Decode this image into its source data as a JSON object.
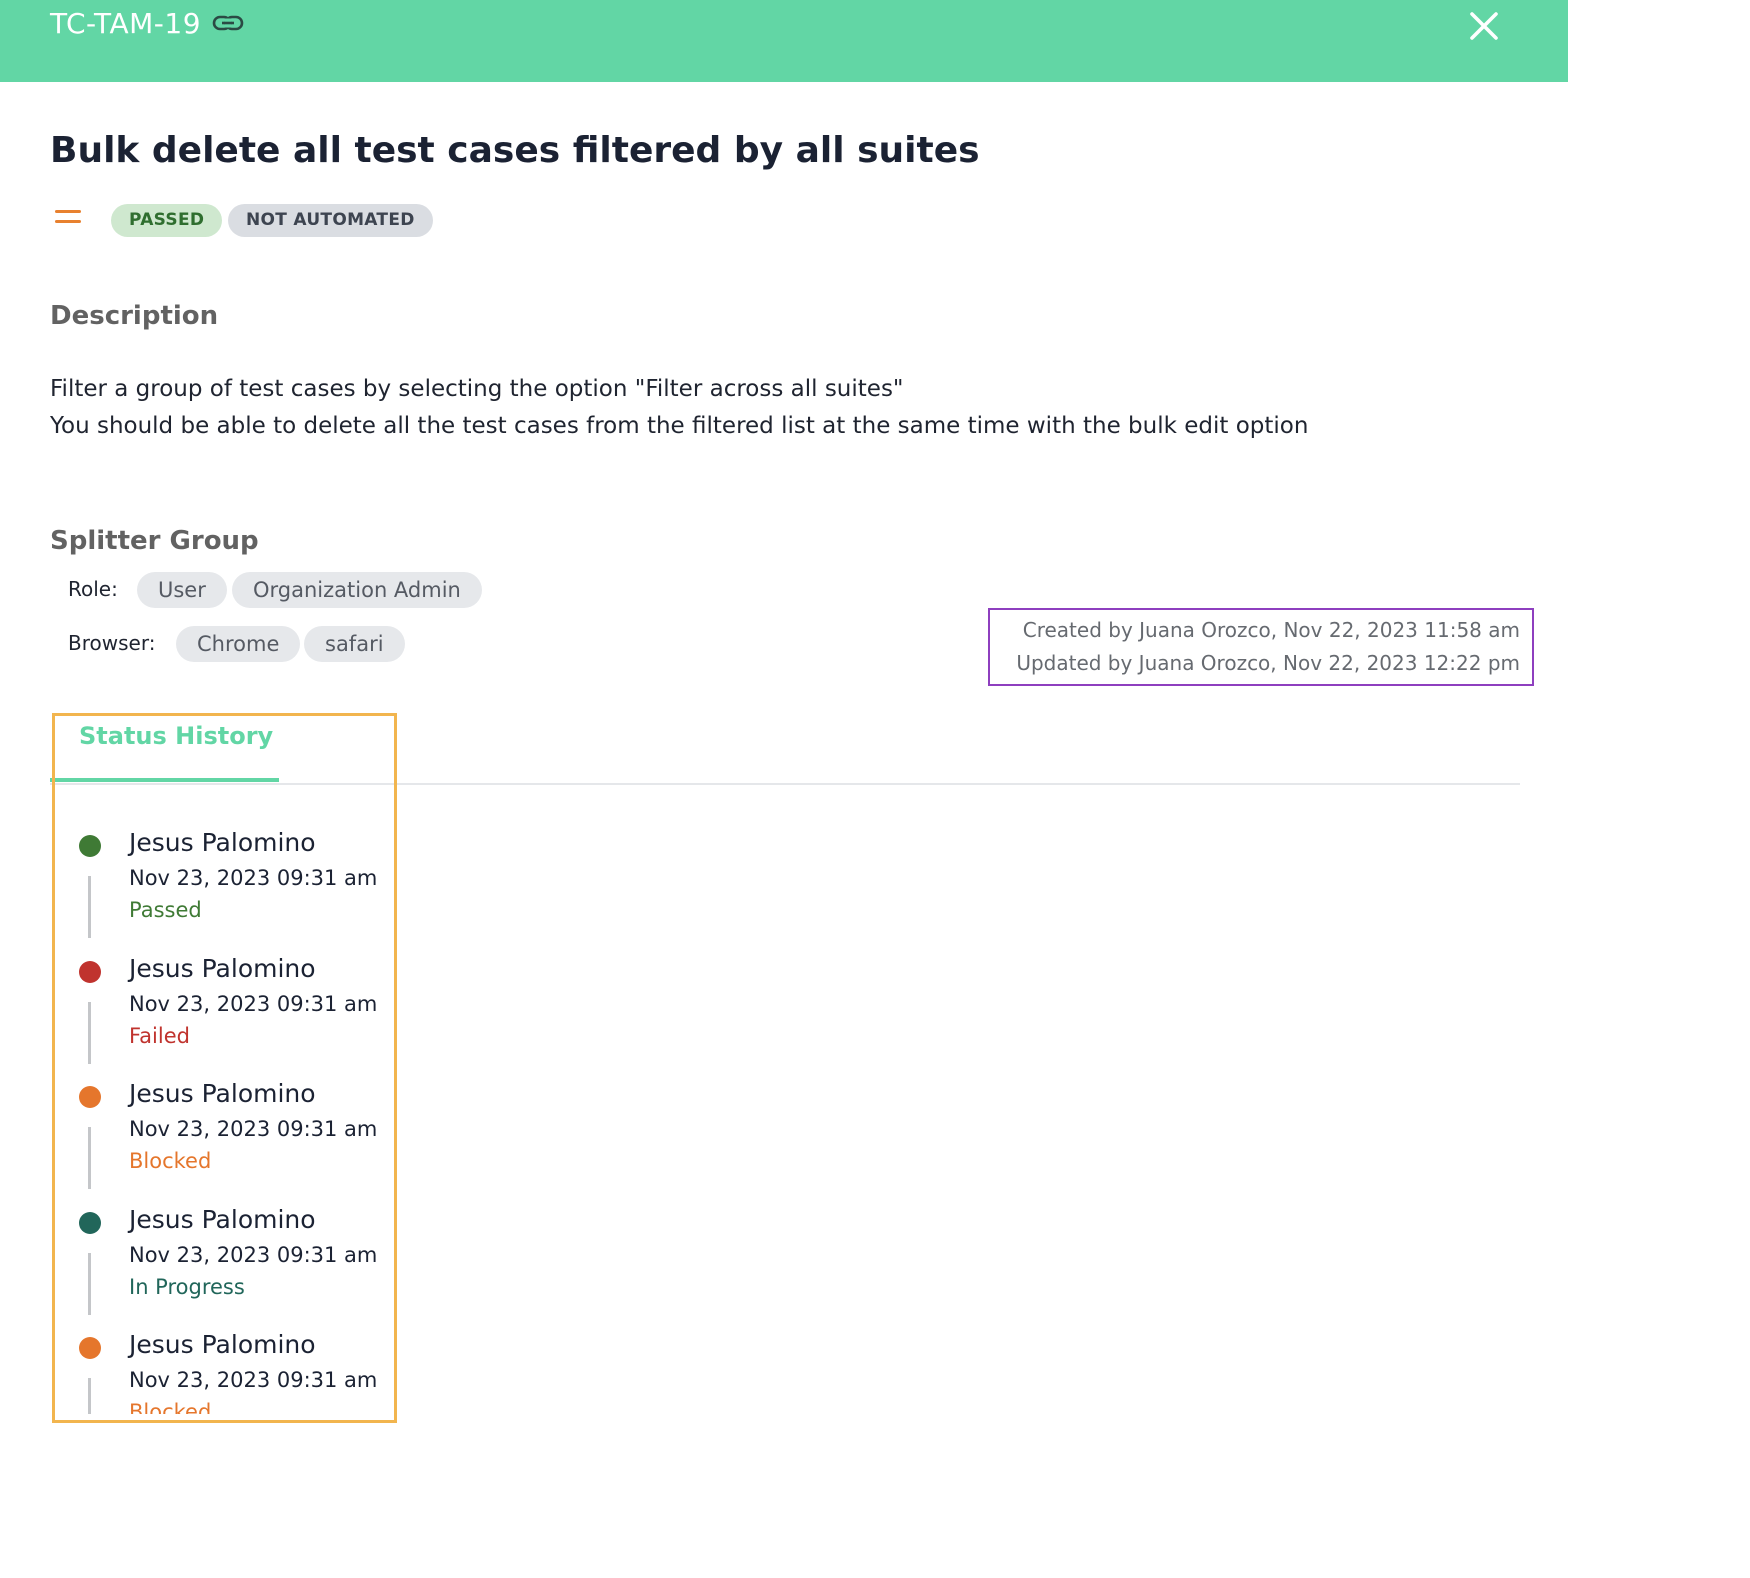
{
  "header": {
    "case_id": "TC-TAM-19",
    "link_icon": "link-icon",
    "close_icon": "close-icon",
    "background": "#62d6a5"
  },
  "test_case": {
    "title": "Bulk delete all test cases filtered by all suites",
    "priority_icon": "priority-medium-icon",
    "status_badge": "PASSED",
    "automation_badge": "NOT AUTOMATED"
  },
  "description": {
    "heading": "Description",
    "lines": [
      "Filter a group of test cases by selecting the option \"Filter across all suites\"",
      "You should be able to delete all the test cases from the filtered list at the same time with the bulk edit option"
    ]
  },
  "splitter_group": {
    "heading": "Splitter Group",
    "role_label": "Role:",
    "roles": [
      "User",
      "Organization Admin"
    ],
    "browser_label": "Browser:",
    "browsers": [
      "Chrome",
      "safari"
    ]
  },
  "meta": {
    "created": "Created by Juana Orozco, Nov 22, 2023 11:58 am",
    "updated": "Updated by Juana Orozco, Nov 22, 2023 12:22 pm"
  },
  "tabs": {
    "status_history_label": "Status History"
  },
  "status_history": [
    {
      "user": "Jesus Palomino",
      "date": "Nov 23, 2023 09:31 am",
      "status": "Passed",
      "color": "#3f7a35"
    },
    {
      "user": "Jesus Palomino",
      "date": "Nov 23, 2023 09:31 am",
      "status": "Failed",
      "color": "#c0332e"
    },
    {
      "user": "Jesus Palomino",
      "date": "Nov 23, 2023 09:31 am",
      "status": "Blocked",
      "color": "#e5762c"
    },
    {
      "user": "Jesus Palomino",
      "date": "Nov 23, 2023 09:31 am",
      "status": "In Progress",
      "color": "#21665a"
    },
    {
      "user": "Jesus Palomino",
      "date": "Nov 23, 2023 09:31 am",
      "status": "Blocked",
      "color": "#e5762c"
    }
  ]
}
